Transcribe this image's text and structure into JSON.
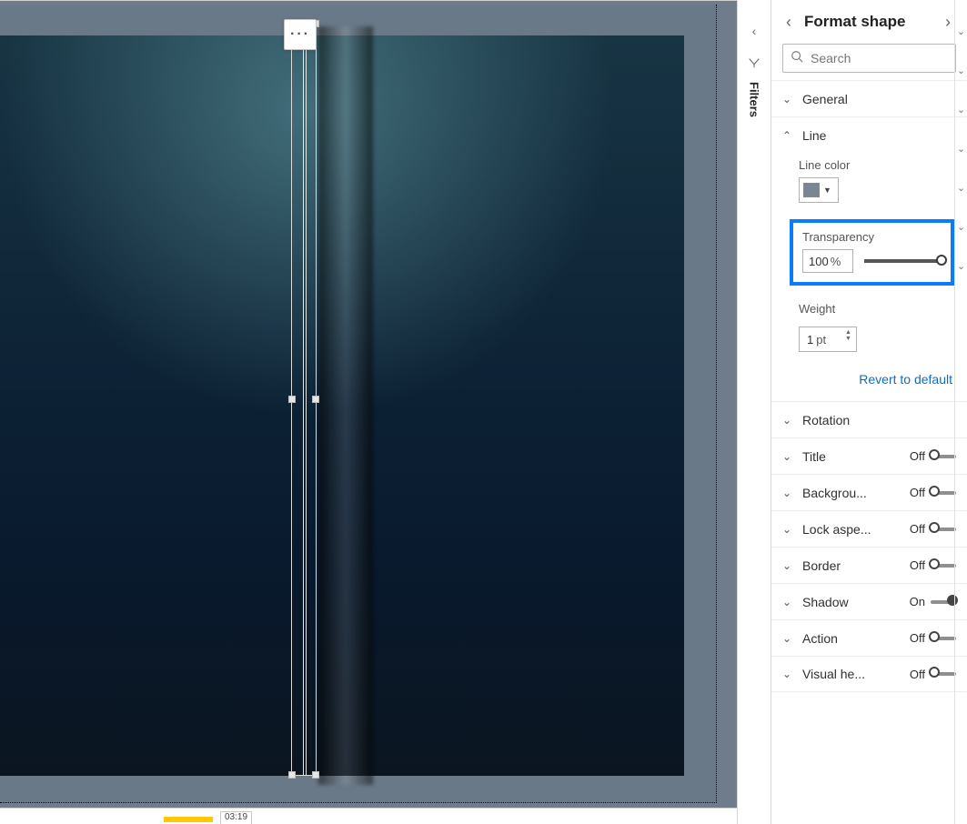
{
  "pane_title": "Format shape",
  "search": {
    "placeholder": "Search"
  },
  "filters_tab_label": "Filters",
  "controls": {
    "on_label": "On",
    "off_label": "Off",
    "revert_label": "Revert to default",
    "transparency_unit": "%",
    "weight_unit": "pt"
  },
  "sections": {
    "general": {
      "label": "General"
    },
    "line": {
      "label": "Line",
      "color_label": "Line color",
      "transparency_label": "Transparency",
      "transparency_value": "100",
      "weight_label": "Weight",
      "weight_value": "1"
    },
    "rotation": {
      "label": "Rotation"
    },
    "title": {
      "label": "Title",
      "state": "Off"
    },
    "background": {
      "label": "Backgrou...",
      "state": "Off"
    },
    "lock_aspect": {
      "label": "Lock aspe...",
      "state": "Off"
    },
    "border": {
      "label": "Border",
      "state": "Off"
    },
    "shadow": {
      "label": "Shadow",
      "state": "On"
    },
    "action": {
      "label": "Action",
      "state": "Off"
    },
    "visual_header": {
      "label": "Visual he...",
      "state": "Off"
    }
  },
  "timeline": {
    "timestamp": "03:19"
  },
  "colors": {
    "line_color_swatch": "#7a8691",
    "highlight": "#0a7cff"
  }
}
